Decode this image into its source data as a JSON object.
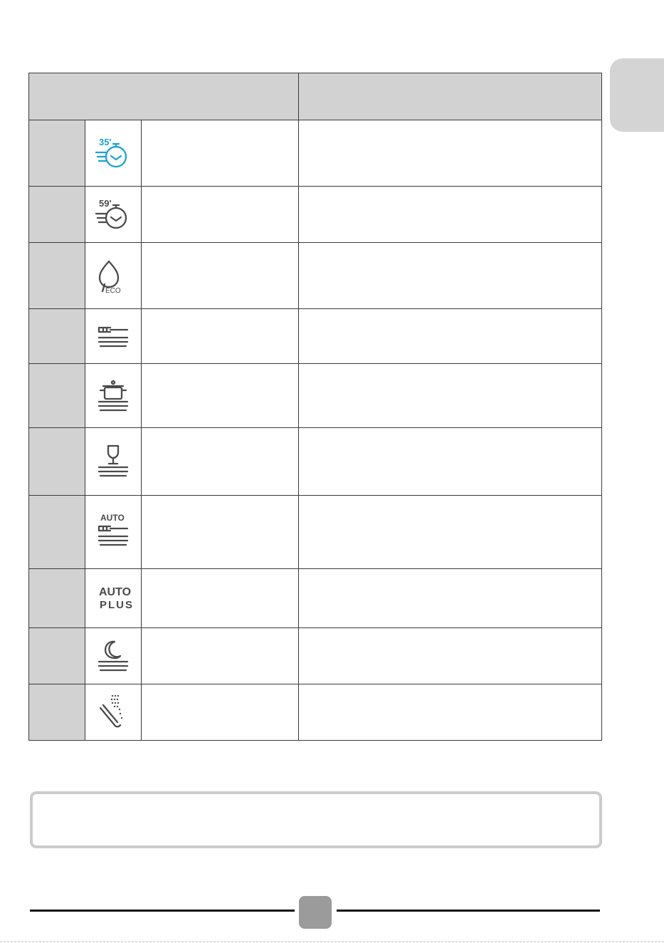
{
  "page": {
    "language_tab": "",
    "page_number": "",
    "note_text": ""
  },
  "table": {
    "header_program": "",
    "header_description": "",
    "rows": [
      {
        "number": "",
        "icon": "quick-35-min-icon",
        "icon_text": "35'",
        "icon_color": "#1aa3d6",
        "name": "",
        "description": ""
      },
      {
        "number": "",
        "icon": "quick-59-min-icon",
        "icon_text": "59'",
        "name": "",
        "description": ""
      },
      {
        "number": "",
        "icon": "eco-leaf-icon",
        "icon_text": "ECO",
        "name": "",
        "description": ""
      },
      {
        "number": "",
        "icon": "fork-plates-icon",
        "name": "",
        "description": ""
      },
      {
        "number": "",
        "icon": "pot-plates-icon",
        "name": "",
        "description": ""
      },
      {
        "number": "",
        "icon": "glass-plates-icon",
        "name": "",
        "description": ""
      },
      {
        "number": "",
        "icon": "auto-fork-plates-icon",
        "icon_text": "AUTO",
        "name": "",
        "description": ""
      },
      {
        "number": "",
        "icon": "auto-plus-icon",
        "icon_text_line1": "AUTO",
        "icon_text_line2": "PLUS",
        "name": "",
        "description": ""
      },
      {
        "number": "",
        "icon": "night-moon-plates-icon",
        "name": "",
        "description": ""
      },
      {
        "number": "",
        "icon": "rinse-spray-icon",
        "name": "",
        "description": ""
      }
    ]
  },
  "colors": {
    "header_bg": "#d2d2d2",
    "icon_gray": "#4a4a4a",
    "icon_blue": "#1aa3d6",
    "note_border": "#cccccc",
    "page_badge": "#9b9b9b"
  }
}
